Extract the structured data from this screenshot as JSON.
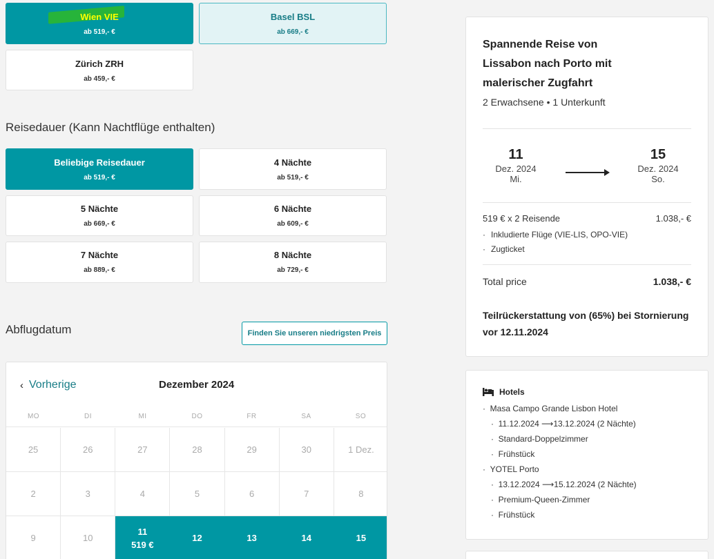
{
  "departure": {
    "options": [
      {
        "name": "Wien VIE",
        "price": "ab 519,- €",
        "state": "selected"
      },
      {
        "name": "Basel BSL",
        "price": "ab 669,- €",
        "state": "light"
      },
      {
        "name": "Zürich ZRH",
        "price": "ab 459,- €",
        "state": "default"
      }
    ]
  },
  "duration": {
    "label": "Reisedauer (Kann Nachtflüge enthalten)",
    "options": [
      {
        "name": "Beliebige Reisedauer",
        "price": "ab 519,- €",
        "state": "selected"
      },
      {
        "name": "4 Nächte",
        "price": "ab 519,- €",
        "state": "default"
      },
      {
        "name": "5 Nächte",
        "price": "ab 669,- €",
        "state": "default"
      },
      {
        "name": "6 Nächte",
        "price": "ab 609,- €",
        "state": "default"
      },
      {
        "name": "7 Nächte",
        "price": "ab 889,- €",
        "state": "default"
      },
      {
        "name": "8 Nächte",
        "price": "ab 729,- €",
        "state": "default"
      }
    ]
  },
  "date_section": {
    "label": "Abflugdatum",
    "lowest_price_button": "Finden Sie unseren niedrigsten Preis"
  },
  "calendar": {
    "prev_label": "Vorherige",
    "month_title": "Dezember 2024",
    "weekdays": [
      "MO",
      "DI",
      "MI",
      "DO",
      "FR",
      "SA",
      "SO"
    ],
    "weeks": [
      [
        {
          "d": "25"
        },
        {
          "d": "26"
        },
        {
          "d": "27"
        },
        {
          "d": "28"
        },
        {
          "d": "29"
        },
        {
          "d": "30"
        },
        {
          "d": "1 Dez."
        }
      ],
      [
        {
          "d": "2"
        },
        {
          "d": "3"
        },
        {
          "d": "4"
        },
        {
          "d": "5"
        },
        {
          "d": "6"
        },
        {
          "d": "7"
        },
        {
          "d": "8"
        }
      ],
      [
        {
          "d": "9"
        },
        {
          "d": "10"
        },
        {
          "d": "11",
          "price": "519 €",
          "avail": true
        },
        {
          "d": "12",
          "avail": true
        },
        {
          "d": "13",
          "avail": true
        },
        {
          "d": "14",
          "avail": true
        },
        {
          "d": "15",
          "avail": true
        }
      ]
    ]
  },
  "summary": {
    "title": "Spannende Reise von Lissabon nach Porto mit malerischer Zugfahrt",
    "travellers": "2 Erwachsene • 1 Unterkunft",
    "start": {
      "day": "11",
      "month": "Dez. 2024",
      "weekday": "Mi."
    },
    "end": {
      "day": "15",
      "month": "Dez. 2024",
      "weekday": "So."
    },
    "price_line": {
      "label": "519 € x 2 Reisende",
      "value": "1.038,- €"
    },
    "inclusions": [
      "Inkludierte Flüge (VIE-LIS, OPO-VIE)",
      "Zugticket"
    ],
    "total": {
      "label": "Total price",
      "value": "1.038,- €"
    },
    "refund": "Teilrückerstattung von (65%) bei Stornierung vor 12.11.2024"
  },
  "hotels": {
    "heading": "Hotels",
    "lines": [
      {
        "text": "Masa Campo Grande Lisbon Hotel",
        "level": 1
      },
      {
        "text": "11.12.2024 ⟶13.12.2024 (2 Nächte)",
        "level": 2
      },
      {
        "text": "Standard-Doppelzimmer",
        "level": 2
      },
      {
        "text": "Frühstück",
        "level": 2
      },
      {
        "text": "YOTEL Porto",
        "level": 1
      },
      {
        "text": "13.12.2024 ⟶15.12.2024 (2 Nächte)",
        "level": 2
      },
      {
        "text": "Premium-Queen-Zimmer",
        "level": 2
      },
      {
        "text": "Frühstück",
        "level": 2
      }
    ]
  }
}
